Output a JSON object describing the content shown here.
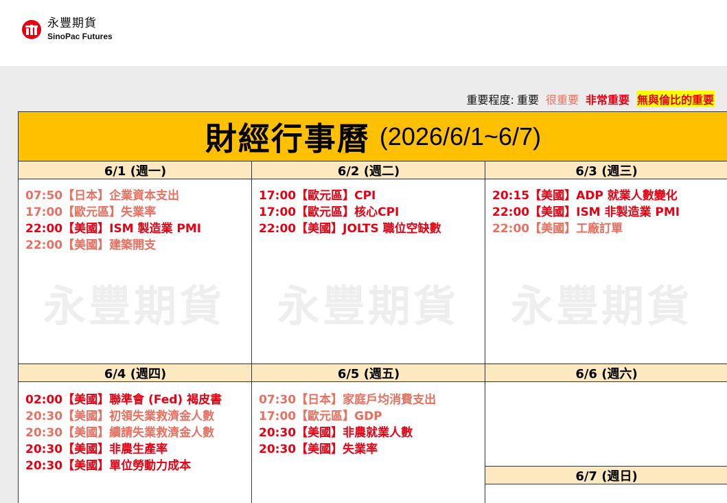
{
  "brand": {
    "name_cn": "永豐期貨",
    "name_en": "SinoPac Futures",
    "icon": "sinopac-logo-icon",
    "color": "#e60012"
  },
  "legend": {
    "label": "重要程度:",
    "level1": "重要",
    "level2": "很重要",
    "level3": "非常重要",
    "level4": "無與倫比的重要"
  },
  "title": {
    "main": "財經行事曆",
    "range": "(2026/6/1~6/7)",
    "background": "#ffc000"
  },
  "watermark": "永豐期貨",
  "colors": {
    "level1": "#111111",
    "level2": "#e87060",
    "level3": "#e60012",
    "level4_bg": "#ffff00",
    "day_header_bg": "#fde9c0"
  },
  "days": [
    {
      "header": "6/1 (週一)",
      "events": [
        {
          "text": "07:50【日本】企業資本支出",
          "level": 2
        },
        {
          "text": "17:00【歐元區】失業率",
          "level": 2
        },
        {
          "text": "22:00【美國】ISM 製造業 PMI",
          "level": 3
        },
        {
          "text": "22:00【美國】建築開支",
          "level": 2
        }
      ]
    },
    {
      "header": "6/2 (週二)",
      "events": [
        {
          "text": "17:00【歐元區】CPI",
          "level": 3
        },
        {
          "text": "17:00【歐元區】核心CPI",
          "level": 3
        },
        {
          "text": "22:00【美國】JOLTS 職位空缺數",
          "level": 3
        }
      ]
    },
    {
      "header": "6/3 (週三)",
      "events": [
        {
          "text": "20:15【美國】ADP 就業人數變化",
          "level": 3
        },
        {
          "text": "22:00【美國】ISM 非製造業 PMI",
          "level": 3
        },
        {
          "text": "22:00【美國】工廠訂單",
          "level": 2
        }
      ]
    },
    {
      "header": "6/4 (週四)",
      "events": [
        {
          "text": "02:00【美國】聯準會 (Fed) 褐皮書",
          "level": 3
        },
        {
          "text": "20:30【美國】初領失業救濟金人數",
          "level": 2
        },
        {
          "text": "20:30【美國】續請失業救濟金人數",
          "level": 2
        },
        {
          "text": "20:30【美國】非農生產率",
          "level": 3
        },
        {
          "text": "20:30【美國】單位勞動力成本",
          "level": 3
        }
      ]
    },
    {
      "header": "6/5 (週五)",
      "events": [
        {
          "text": "07:30【日本】家庭戶均消費支出",
          "level": 2
        },
        {
          "text": "17:00【歐元區】GDP",
          "level": 2
        },
        {
          "text": "20:30【美國】非農就業人數",
          "level": 3
        },
        {
          "text": "20:30【美國】失業率",
          "level": 3
        }
      ]
    },
    {
      "header": "6/6 (週六)",
      "events": []
    },
    {
      "header": "6/7 (週日)",
      "events": []
    }
  ]
}
